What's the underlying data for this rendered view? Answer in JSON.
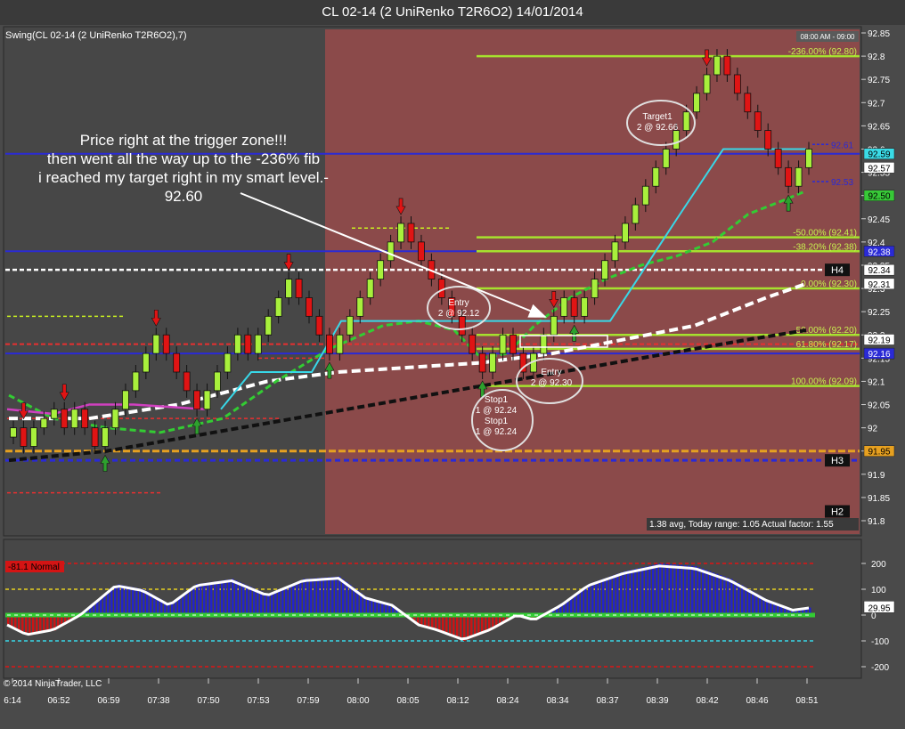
{
  "window": {
    "title": "CL 02-14 (2 UniRenko T2R6O2)  14/01/2014"
  },
  "chart_data": [
    {
      "type": "candlestick",
      "instrument_label": "Swing(CL 02-14 (2 UniRenko T2R6O2),7)",
      "session_label": "08:00 AM - 09:00",
      "ylim": [
        91.75,
        92.87
      ],
      "y_ticks": [
        92.85,
        92.8,
        92.75,
        92.7,
        92.65,
        92.6,
        92.55,
        92.5,
        92.45,
        92.4,
        92.35,
        92.3,
        92.25,
        92.2,
        92.15,
        92.1,
        92.05,
        92.0,
        91.95,
        91.9,
        91.85,
        91.8
      ],
      "x_ticks": [
        "6:14",
        "06:52",
        "06:59",
        "07:38",
        "07:50",
        "07:53",
        "07:59",
        "08:00",
        "08:05",
        "08:12",
        "08:24",
        "08:34",
        "08:37",
        "08:39",
        "08:42",
        "08:46",
        "08:51"
      ],
      "bricks": [
        {
          "o": 91.98,
          "c": 92.0
        },
        {
          "o": 92.0,
          "c": 91.96
        },
        {
          "o": 91.96,
          "c": 92.0
        },
        {
          "o": 92.0,
          "c": 92.02
        },
        {
          "o": 92.02,
          "c": 92.04
        },
        {
          "o": 92.04,
          "c": 92.0
        },
        {
          "o": 92.0,
          "c": 92.04
        },
        {
          "o": 92.04,
          "c": 92.0
        },
        {
          "o": 92.0,
          "c": 91.96
        },
        {
          "o": 91.96,
          "c": 92.0
        },
        {
          "o": 92.0,
          "c": 92.04
        },
        {
          "o": 92.04,
          "c": 92.08
        },
        {
          "o": 92.08,
          "c": 92.12
        },
        {
          "o": 92.12,
          "c": 92.16
        },
        {
          "o": 92.16,
          "c": 92.2
        },
        {
          "o": 92.2,
          "c": 92.16
        },
        {
          "o": 92.16,
          "c": 92.12
        },
        {
          "o": 92.12,
          "c": 92.08
        },
        {
          "o": 92.08,
          "c": 92.04
        },
        {
          "o": 92.04,
          "c": 92.08
        },
        {
          "o": 92.08,
          "c": 92.12
        },
        {
          "o": 92.12,
          "c": 92.16
        },
        {
          "o": 92.16,
          "c": 92.2
        },
        {
          "o": 92.2,
          "c": 92.16
        },
        {
          "o": 92.16,
          "c": 92.2
        },
        {
          "o": 92.2,
          "c": 92.24
        },
        {
          "o": 92.24,
          "c": 92.28
        },
        {
          "o": 92.28,
          "c": 92.32
        },
        {
          "o": 92.32,
          "c": 92.28
        },
        {
          "o": 92.28,
          "c": 92.24
        },
        {
          "o": 92.24,
          "c": 92.2
        },
        {
          "o": 92.2,
          "c": 92.16
        },
        {
          "o": 92.16,
          "c": 92.2
        },
        {
          "o": 92.2,
          "c": 92.24
        },
        {
          "o": 92.24,
          "c": 92.28
        },
        {
          "o": 92.28,
          "c": 92.32
        },
        {
          "o": 92.32,
          "c": 92.36
        },
        {
          "o": 92.36,
          "c": 92.4
        },
        {
          "o": 92.4,
          "c": 92.44
        },
        {
          "o": 92.44,
          "c": 92.4
        },
        {
          "o": 92.4,
          "c": 92.36
        },
        {
          "o": 92.36,
          "c": 92.32
        },
        {
          "o": 92.32,
          "c": 92.28
        },
        {
          "o": 92.28,
          "c": 92.24
        },
        {
          "o": 92.24,
          "c": 92.2
        },
        {
          "o": 92.2,
          "c": 92.16
        },
        {
          "o": 92.16,
          "c": 92.12
        },
        {
          "o": 92.12,
          "c": 92.16
        },
        {
          "o": 92.16,
          "c": 92.2
        },
        {
          "o": 92.2,
          "c": 92.16
        },
        {
          "o": 92.16,
          "c": 92.12
        },
        {
          "o": 92.12,
          "c": 92.16
        },
        {
          "o": 92.16,
          "c": 92.2
        },
        {
          "o": 92.2,
          "c": 92.24
        },
        {
          "o": 92.24,
          "c": 92.28
        },
        {
          "o": 92.28,
          "c": 92.24
        },
        {
          "o": 92.24,
          "c": 92.28
        },
        {
          "o": 92.28,
          "c": 92.32
        },
        {
          "o": 92.32,
          "c": 92.36
        },
        {
          "o": 92.36,
          "c": 92.4
        },
        {
          "o": 92.4,
          "c": 92.44
        },
        {
          "o": 92.44,
          "c": 92.48
        },
        {
          "o": 92.48,
          "c": 92.52
        },
        {
          "o": 92.52,
          "c": 92.56
        },
        {
          "o": 92.56,
          "c": 92.6
        },
        {
          "o": 92.6,
          "c": 92.64
        },
        {
          "o": 92.64,
          "c": 92.68
        },
        {
          "o": 92.68,
          "c": 92.72
        },
        {
          "o": 92.72,
          "c": 92.76
        },
        {
          "o": 92.76,
          "c": 92.8
        },
        {
          "o": 92.8,
          "c": 92.76
        },
        {
          "o": 92.76,
          "c": 92.72
        },
        {
          "o": 92.72,
          "c": 92.68
        },
        {
          "o": 92.68,
          "c": 92.64
        },
        {
          "o": 92.64,
          "c": 92.6
        },
        {
          "o": 92.6,
          "c": 92.56
        },
        {
          "o": 92.56,
          "c": 92.52
        },
        {
          "o": 92.52,
          "c": 92.56
        },
        {
          "o": 92.56,
          "c": 92.6
        }
      ],
      "signals": [
        {
          "i": 1,
          "type": "down"
        },
        {
          "i": 5,
          "type": "down"
        },
        {
          "i": 9,
          "type": "up"
        },
        {
          "i": 14,
          "type": "down"
        },
        {
          "i": 18,
          "type": "up"
        },
        {
          "i": 27,
          "type": "down"
        },
        {
          "i": 31,
          "type": "up"
        },
        {
          "i": 38,
          "type": "down"
        },
        {
          "i": 46,
          "type": "up"
        },
        {
          "i": 53,
          "type": "down"
        },
        {
          "i": 55,
          "type": "up"
        },
        {
          "i": 68,
          "type": "down"
        },
        {
          "i": 76,
          "type": "up"
        }
      ],
      "fib_levels": [
        {
          "label": "-236.00% (92.80)",
          "value": 92.8
        },
        {
          "label": "-50.00% (92.41)",
          "value": 92.41
        },
        {
          "label": "-38.20% (92.38)",
          "value": 92.38
        },
        {
          "label": "0.00% (92.30)",
          "value": 92.3
        },
        {
          "label": "50.00% (92.20)",
          "value": 92.2
        },
        {
          "label": "61.80% (92.17)",
          "value": 92.17
        },
        {
          "label": "100.00% (92.09)",
          "value": 92.09
        }
      ],
      "price_tags": [
        {
          "label": "92.59",
          "value": 92.59,
          "color": "#3adbe6"
        },
        {
          "label": "92.57",
          "value": 92.56,
          "color": "#ffffff"
        },
        {
          "label": "92.50",
          "value": 92.5,
          "color": "#37c837"
        },
        {
          "label": "92.38",
          "value": 92.38,
          "color": "#2a2ad6"
        },
        {
          "label": "92.34",
          "value": 92.34,
          "color": "#ffffff"
        },
        {
          "label": "92.31",
          "value": 92.31,
          "color": "#ffffff"
        },
        {
          "label": "92.19",
          "value": 92.19,
          "color": "#ffffff"
        },
        {
          "label": "92.16",
          "value": 92.16,
          "color": "#2a2ad6"
        },
        {
          "label": "91.95",
          "value": 91.95,
          "color": "#e6a020"
        }
      ],
      "pivots": [
        {
          "label": "H4",
          "value": 92.34
        },
        {
          "label": "H3",
          "value": 91.93
        },
        {
          "label": "H2",
          "value": 91.82
        }
      ],
      "swing_labels": [
        {
          "label": "92.61",
          "value": 92.61
        },
        {
          "label": "92.53",
          "value": 92.53
        }
      ],
      "annotations": {
        "comment": [
          "Price right at the trigger zone!!!",
          "then went all the way up to the -236% fib",
          "i reached my target right in my smart level.-",
          "92.60"
        ],
        "entry1": [
          "Entry",
          "2 @ 92.12"
        ],
        "entry2": [
          "Entry",
          "2 @ 92.30"
        ],
        "stop1a": [
          "Stop1",
          "1 @ 92.24"
        ],
        "stop1b": [
          "Stop1",
          "1 @ 92.24"
        ],
        "target1": [
          "Target1",
          "2 @ 92.66"
        ],
        "range_info": "1.38 avg, Today range: 1.05  Actual factor: 1.55"
      },
      "colors": {
        "bull": "#a8f03c",
        "bear": "#e01414",
        "session_bg": "#8b4a4a",
        "cyan_line": "#38d8e8",
        "green_ma": "#33cc33"
      }
    },
    {
      "type": "bar",
      "panel_label": "-81.1 Normal",
      "ylim": [
        -240,
        240
      ],
      "y_ticks": [
        200,
        100,
        0,
        -100,
        -200
      ],
      "last_value": "29.95",
      "copyright": "© 2014 NinjaTrader, LLC"
    }
  ]
}
